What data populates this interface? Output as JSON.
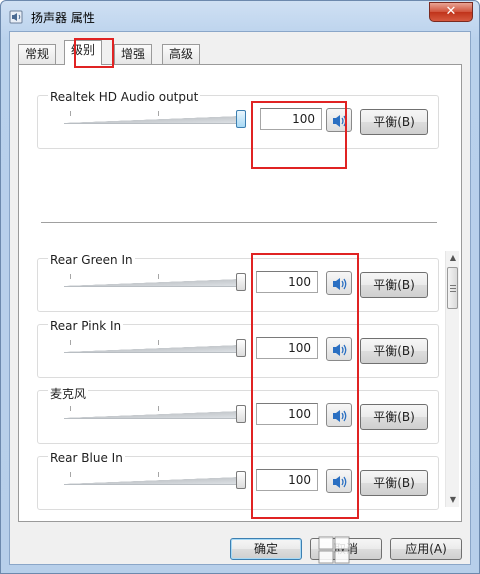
{
  "window": {
    "title": "扬声器 属性",
    "close_label": "✕"
  },
  "tabs": [
    {
      "label": "常规",
      "active": false
    },
    {
      "label": "级别",
      "active": true
    },
    {
      "label": "增强",
      "active": false
    },
    {
      "label": "高级",
      "active": false
    }
  ],
  "master": {
    "label": "Realtek HD Audio output",
    "value": "100",
    "level": 1.0,
    "balance_label": "平衡(B)"
  },
  "channels": [
    {
      "label": "Rear Green In",
      "value": "100",
      "level": 1.0,
      "balance_label": "平衡(B)"
    },
    {
      "label": "Rear Pink In",
      "value": "100",
      "level": 1.0,
      "balance_label": "平衡(B)"
    },
    {
      "label": "麦克风",
      "value": "100",
      "level": 1.0,
      "balance_label": "平衡(B)"
    },
    {
      "label": "Rear Blue In",
      "value": "100",
      "level": 1.0,
      "balance_label": "平衡(B)"
    }
  ],
  "buttons": {
    "ok": "确定",
    "cancel": "取消",
    "apply": "应用(A)"
  },
  "icons": {
    "speaker": "speaker-icon",
    "close": "close-icon",
    "title": "speaker-properties-icon"
  },
  "colors": {
    "annotation_red": "#e02323",
    "speaker_blue": "#2a6fc2"
  }
}
